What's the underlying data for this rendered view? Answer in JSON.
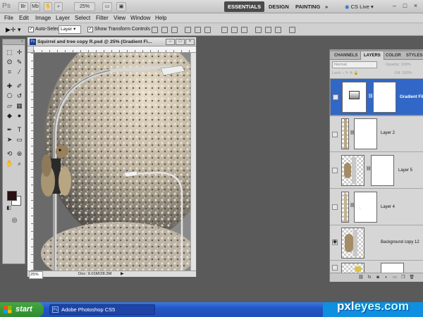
{
  "app": {
    "logo": "Ps",
    "zoom": "25%",
    "workspaces": [
      "ESSENTIALS",
      "DESIGN",
      "PAINTING"
    ],
    "more": "»",
    "cslive": "CS Live",
    "window_controls": [
      "–",
      "□",
      "×"
    ]
  },
  "menu": [
    "File",
    "Edit",
    "Image",
    "Layer",
    "Select",
    "Filter",
    "View",
    "Window",
    "Help"
  ],
  "options": {
    "auto_select": "Auto-Select:",
    "auto_select_value": "Layer",
    "show_transform": "Show Transform Controls"
  },
  "document": {
    "title": "Squirrel and tree copy R.psd @ 25% (Gradient Fi...",
    "zoom": "25%",
    "doc_size": "Doc: 9.01M/28.3M",
    "buttons": [
      "–",
      "□",
      "×"
    ]
  },
  "panel": {
    "tabs": [
      "CHANNELS",
      "LAYERS",
      "COLOR",
      "STYLES"
    ],
    "active_tab": "LAYERS",
    "blend_mode": "Normal",
    "opacity_label": "Opacity: 100%",
    "lock_label": "Lock:",
    "fill_label": "Fill: 100%",
    "layers": [
      {
        "name": "Gradient Fil",
        "selected": true,
        "visible": false
      },
      {
        "name": "Layer 2",
        "selected": false,
        "visible": false
      },
      {
        "name": "Layer 5",
        "selected": false,
        "visible": false
      },
      {
        "name": "Layer 4",
        "selected": false,
        "visible": false
      },
      {
        "name": "Background copy 12",
        "selected": false,
        "visible": true
      },
      {
        "name": "",
        "selected": false,
        "visible": false
      }
    ]
  },
  "taskbar": {
    "start": "start",
    "task": "Adobe Photoshop CS5",
    "watermark_a": "pxl",
    "watermark_b": "eyes.com"
  },
  "colors": {
    "accent": "#3167c6",
    "foreground_swatch": "#2a1115",
    "background_swatch": "#ffffff"
  }
}
